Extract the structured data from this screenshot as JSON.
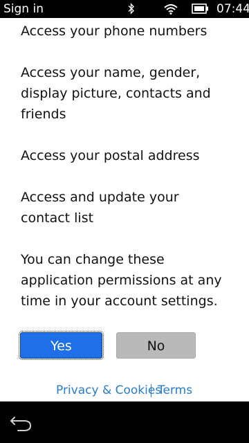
{
  "status_bar": {
    "title": "Sign in",
    "time": "07:44",
    "icons": [
      "bluetooth-icon",
      "wifi-icon",
      "battery-icon"
    ]
  },
  "permissions": [
    "Access your phone numbers",
    "Access your name, gender, display picture, contacts and friends",
    "Access your postal address",
    "Access and update your contact list"
  ],
  "note": "You can change these application permissions at any time in your account settings.",
  "buttons": {
    "yes": "Yes",
    "no": "No"
  },
  "footer": {
    "privacy": "Privacy & Cookies",
    "terms": "Terms"
  },
  "nav": {
    "back_icon": "back-arrow-icon"
  },
  "colors": {
    "accent": "#1f6fe8",
    "link": "#2a7cc7",
    "secondary_button": "#b9b9b9"
  }
}
